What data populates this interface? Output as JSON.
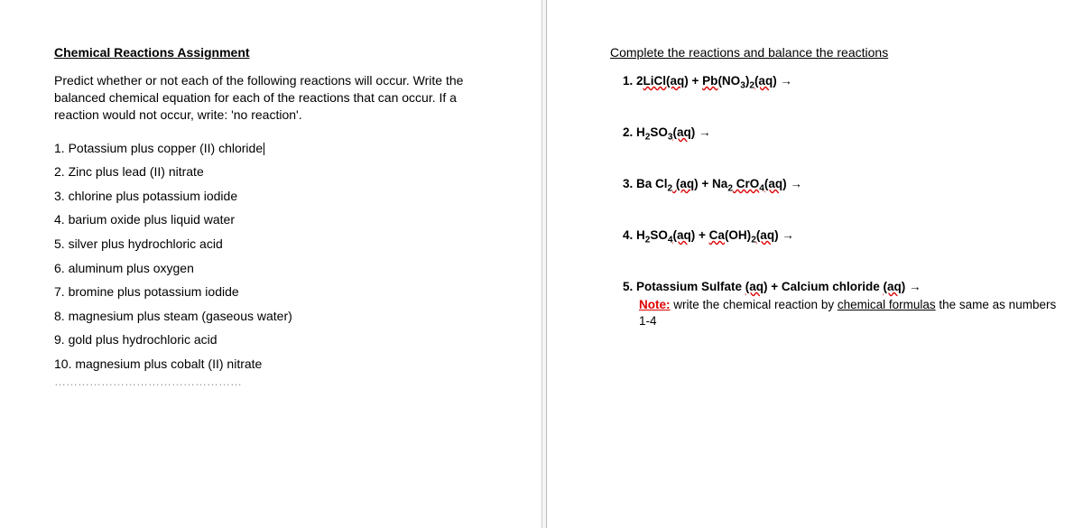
{
  "left": {
    "title": "Chemical Reactions Assignment",
    "instructions": "Predict whether or not each of the following reactions will occur. Write the balanced chemical equation for each of the reactions that can occur. If a reaction would not occur, write: 'no reaction'.",
    "questions": [
      "1. Potassium plus copper (II) chloride",
      "2. Zinc plus lead (II) nitrate",
      "3. chlorine plus potassium iodide",
      "4. barium oxide plus liquid water",
      "5. silver plus hydrochloric acid",
      "6. aluminum plus oxygen",
      "7. bromine plus potassium iodide",
      "8. magnesium plus steam (gaseous water)",
      "9. gold plus hydrochloric acid",
      "10. magnesium plus cobalt (II) nitrate"
    ],
    "separator": "…………………………………………"
  },
  "right": {
    "title": "Complete the reactions and balance the reactions",
    "eq1_prefix": "1.  2",
    "eq1_licl": "LiCl(aq",
    "eq1_mid": ") + ",
    "eq1_pb": "Pb",
    "eq1_no3": "(NO",
    "eq1_sub3": "3",
    "eq1_paren": ")",
    "eq1_sub2": "2",
    "eq1_aq": "(aq",
    "eq1_end": ")  →",
    "eq2_prefix": "2.  H",
    "eq2_sub2": "2",
    "eq2_so": "SO",
    "eq2_sub3": "3",
    "eq2_aq": "(aq",
    "eq2_end": ")  →",
    "eq3_prefix": "3.  Ba Cl",
    "eq3_sub2a": "2",
    "eq3_aq1": " (aq",
    "eq3_mid": ")  +  Na",
    "eq3_sub2b": "2",
    "eq3_cro": " CrO",
    "eq3_sub4": "4",
    "eq3_aq2": "(aq",
    "eq3_end": ")  →",
    "eq4_prefix": "4.  H",
    "eq4_sub2a": "2",
    "eq4_so": "SO",
    "eq4_sub4": "4",
    "eq4_aq1": "(aq",
    "eq4_mid": ")  +  ",
    "eq4_ca": "Ca",
    "eq4_oh": "(OH)",
    "eq4_sub2b": "2",
    "eq4_aq2": "(aq",
    "eq4_end": ")  →",
    "eq5_prefix": "5.  Potassium Sulfate ",
    "eq5_aq1": "(aq",
    "eq5_mid": ")  + Calcium chloride ",
    "eq5_aq2": "(aq",
    "eq5_end": ")  →",
    "note_label": "Note:",
    "note_text1": " write the chemical reaction by ",
    "note_underline": "chemical formulas",
    "note_text2": " the same as numbers 1-4"
  }
}
